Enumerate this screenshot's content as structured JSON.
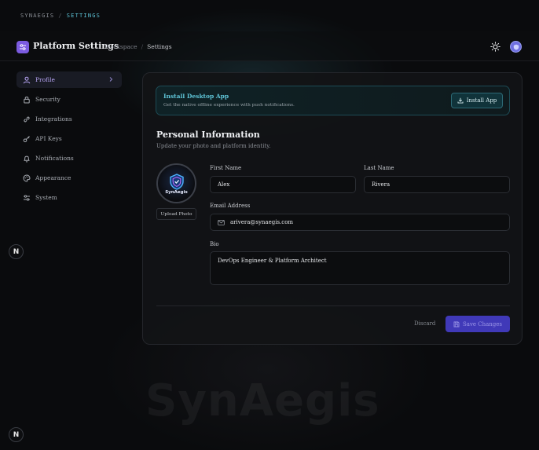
{
  "breadcrumb_top": {
    "app": "SYNAEGIS",
    "sep": "/",
    "current": "SETTINGS"
  },
  "header": {
    "title": "Platform Settings",
    "breadcrumb": [
      "Workspace",
      "Settings"
    ],
    "breadcrumb_sep": "/"
  },
  "sidebar": {
    "items": [
      {
        "label": "Profile",
        "icon": "user-icon",
        "active": true
      },
      {
        "label": "Security",
        "icon": "lock-icon"
      },
      {
        "label": "Integrations",
        "icon": "link-icon"
      },
      {
        "label": "API Keys",
        "icon": "key-icon"
      },
      {
        "label": "Notifications",
        "icon": "bell-icon"
      },
      {
        "label": "Appearance",
        "icon": "palette-icon"
      },
      {
        "label": "System",
        "icon": "sliders-icon"
      }
    ]
  },
  "badges": {
    "n_letter": "N"
  },
  "install_banner": {
    "title": "Install Desktop App",
    "subtitle": "Get the native offline experience with push notifications.",
    "button": "Install App"
  },
  "personal": {
    "title": "Personal Information",
    "subtitle": "Update your photo and platform identity.",
    "avatar_brand": "SynAegis",
    "upload_label": "Upload Photo",
    "first_name_label": "First Name",
    "first_name": "Alex",
    "last_name_label": "Last Name",
    "last_name": "Rivera",
    "email_label": "Email Address",
    "email": "arivera@synaegis.com",
    "bio_label": "Bio",
    "bio": "DevOps Engineer & Platform Architect"
  },
  "actions": {
    "discard": "Discard",
    "save": "Save Changes"
  },
  "watermark": "SynAegis",
  "colors": {
    "accent_purple": "#7b5be0",
    "accent_cyan": "#5fc5d8",
    "save_bg": "#4039b8"
  }
}
